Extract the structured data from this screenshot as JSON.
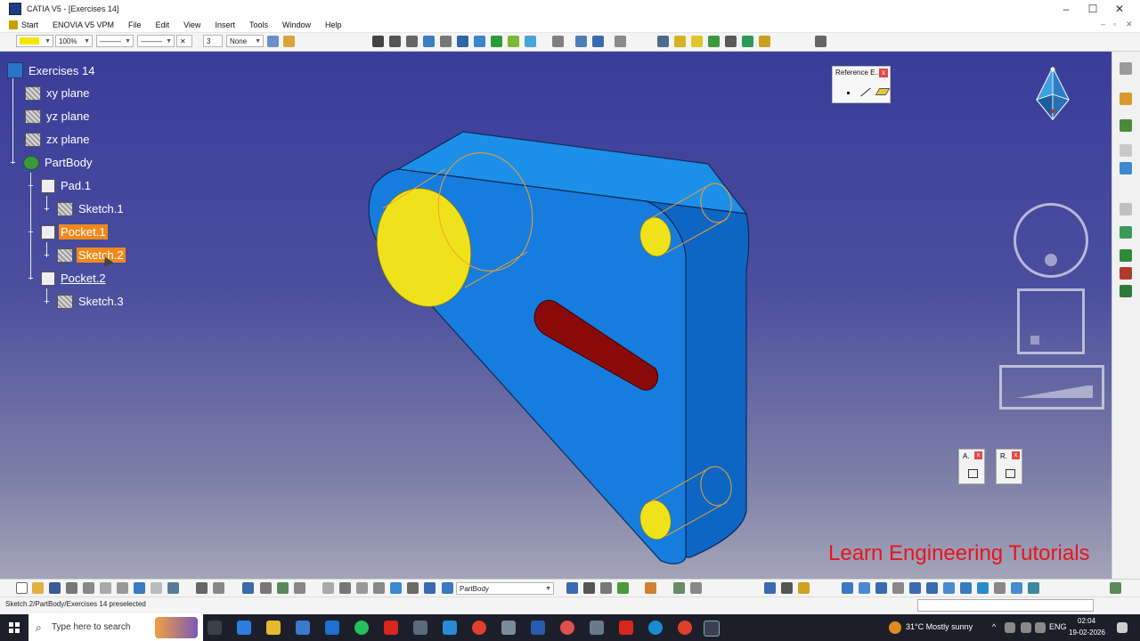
{
  "window": {
    "title": "CATIA V5 - [Exercises 14]",
    "controls": [
      "–",
      "☐",
      "✕"
    ],
    "inner_controls": [
      "–",
      "▫",
      "✕"
    ]
  },
  "menu": {
    "items": [
      "Start",
      "ENOVIA V5 VPM",
      "File",
      "Edit",
      "View",
      "Insert",
      "Tools",
      "Window",
      "Help"
    ]
  },
  "toolbar_top": {
    "color_value": "",
    "transparency_value": "100%",
    "line_type_value": "———",
    "line_weight_value": "———",
    "point_symbol": "✕",
    "layer_number": "3",
    "layer_value": "None"
  },
  "tree": {
    "root": "Exercises 14",
    "planes": [
      "xy plane",
      "yz plane",
      "zx plane"
    ],
    "body": "PartBody",
    "features": [
      {
        "label": "Pad.1",
        "sketch": "Sketch.1",
        "selected": false,
        "sketch_selected": false
      },
      {
        "label": "Pocket.1",
        "sketch": "Sketch.2",
        "selected": true,
        "sketch_selected": true
      },
      {
        "label": "Pocket.2",
        "sketch": "Sketch.3",
        "selected": false,
        "sketch_selected": false
      }
    ]
  },
  "reference_panel": {
    "title": "Reference E...",
    "close": "x"
  },
  "mini_toolbars": [
    {
      "label": "A.",
      "close": "x"
    },
    {
      "label": "R.",
      "close": "x"
    }
  ],
  "watermark": "Learn Engineering Tutorials",
  "toolbar_bottom": {
    "body_select_value": "PartBody"
  },
  "status": {
    "text": "Sketch.2/PartBody/Exercises 14 preselected"
  },
  "taskbar": {
    "search_placeholder": "Type here to search",
    "weather": "31°C  Mostly sunny",
    "language": "ENG",
    "time": "02:04",
    "date": "19-02-2026"
  },
  "colors": {
    "model_face": "#1176d8",
    "model_edge": "#0a3d7a",
    "hole": "#f0e21a",
    "slot": "#8a0a0a",
    "selection": "#f08a1c",
    "watermark": "#e8141b"
  }
}
